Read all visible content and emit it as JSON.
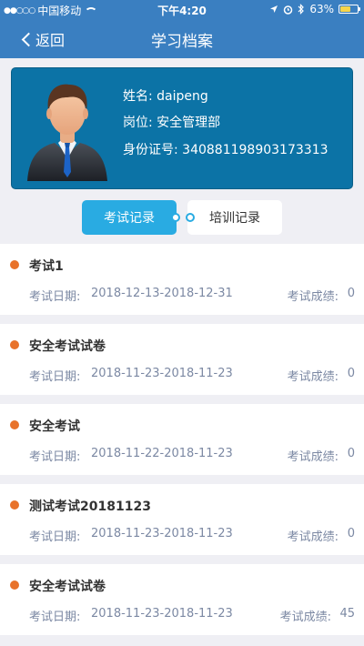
{
  "status_bar": {
    "carrier": "中国移动",
    "time": "下午4:20",
    "battery": "63%",
    "battery_level": 0.63
  },
  "nav": {
    "back_label": "返回",
    "title": "学习档案"
  },
  "profile": {
    "name_label": "姓名:",
    "name": "daipeng",
    "position_label": "岗位:",
    "position": "安全管理部",
    "id_label": "身份证号:",
    "id_number": "340881198903173313"
  },
  "tabs": {
    "exam": "考试记录",
    "training": "培训记录"
  },
  "records": [
    {
      "name": "考试1",
      "date_label": "考试日期:",
      "date": "2018-12-13-2018-12-31",
      "score_label": "考试成绩:",
      "score": "0"
    },
    {
      "name": "安全考试试卷",
      "date_label": "考试日期:",
      "date": "2018-11-23-2018-11-23",
      "score_label": "考试成绩:",
      "score": "0"
    },
    {
      "name": "安全考试",
      "date_label": "考试日期:",
      "date": "2018-11-22-2018-11-23",
      "score_label": "考试成绩:",
      "score": "0"
    },
    {
      "name": "测试考试20181123",
      "date_label": "考试日期:",
      "date": "2018-11-23-2018-11-23",
      "score_label": "考试成绩:",
      "score": "0"
    },
    {
      "name": "安全考试试卷",
      "date_label": "考试日期:",
      "date": "2018-11-23-2018-11-23",
      "score_label": "考试成绩:",
      "score": "45"
    }
  ],
  "colors": {
    "nav": "#3a7fc1",
    "profile_card": "#0c73a6",
    "active_tab": "#29abe2",
    "bullet": "#e8722a"
  }
}
